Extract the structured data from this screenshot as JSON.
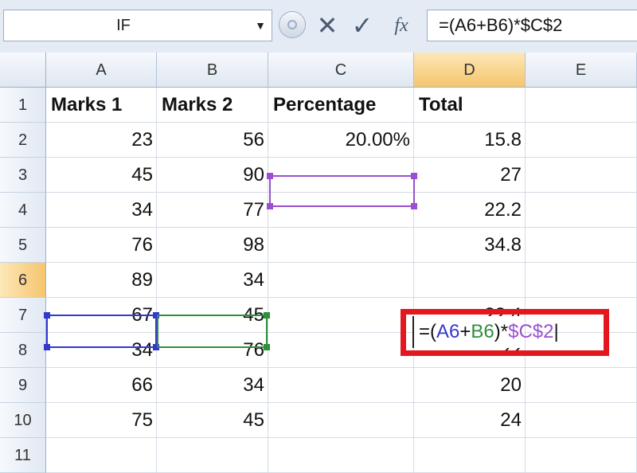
{
  "name_box": {
    "value": "IF"
  },
  "formula_bar": {
    "cancel_glyph": "✕",
    "enter_glyph": "✓",
    "fx_label": "fx",
    "formula": "=(A6+B6)*$C$2"
  },
  "columns": [
    "A",
    "B",
    "C",
    "D",
    "E"
  ],
  "rows": [
    "1",
    "2",
    "3",
    "4",
    "5",
    "6",
    "7",
    "8",
    "9",
    "10",
    "11"
  ],
  "headers": {
    "A": "Marks 1",
    "B": "Marks 2",
    "C": "Percentage",
    "D": "Total"
  },
  "data": [
    {
      "A": "23",
      "B": "56",
      "C": "20.00%",
      "D": "15.8"
    },
    {
      "A": "45",
      "B": "90",
      "C": "",
      "D": "27"
    },
    {
      "A": "34",
      "B": "77",
      "C": "",
      "D": "22.2"
    },
    {
      "A": "76",
      "B": "98",
      "C": "",
      "D": "34.8"
    },
    {
      "A": "89",
      "B": "34",
      "C": "",
      "D": ""
    },
    {
      "A": "67",
      "B": "45",
      "C": "",
      "D": "22.4"
    },
    {
      "A": "34",
      "B": "76",
      "C": "",
      "D": "22"
    },
    {
      "A": "66",
      "B": "34",
      "C": "",
      "D": "20"
    },
    {
      "A": "75",
      "B": "45",
      "C": "",
      "D": "24"
    }
  ],
  "edit_cell": {
    "ref": "D6",
    "parts": [
      {
        "text": "=(",
        "color": "#111111"
      },
      {
        "text": "A6",
        "color": "#3438cf"
      },
      {
        "text": "+",
        "color": "#111111"
      },
      {
        "text": "B6",
        "color": "#2f8f3a"
      },
      {
        "text": ")*",
        "color": "#111111"
      },
      {
        "text": "$C$2",
        "color": "#9b4fd0"
      }
    ]
  },
  "colors": {
    "ref_a6": "#3438cf",
    "ref_b6": "#2f8f3a",
    "ref_c2": "#9b4fd0",
    "highlight": "#e3171e",
    "header_selected": "#f5c56d"
  }
}
